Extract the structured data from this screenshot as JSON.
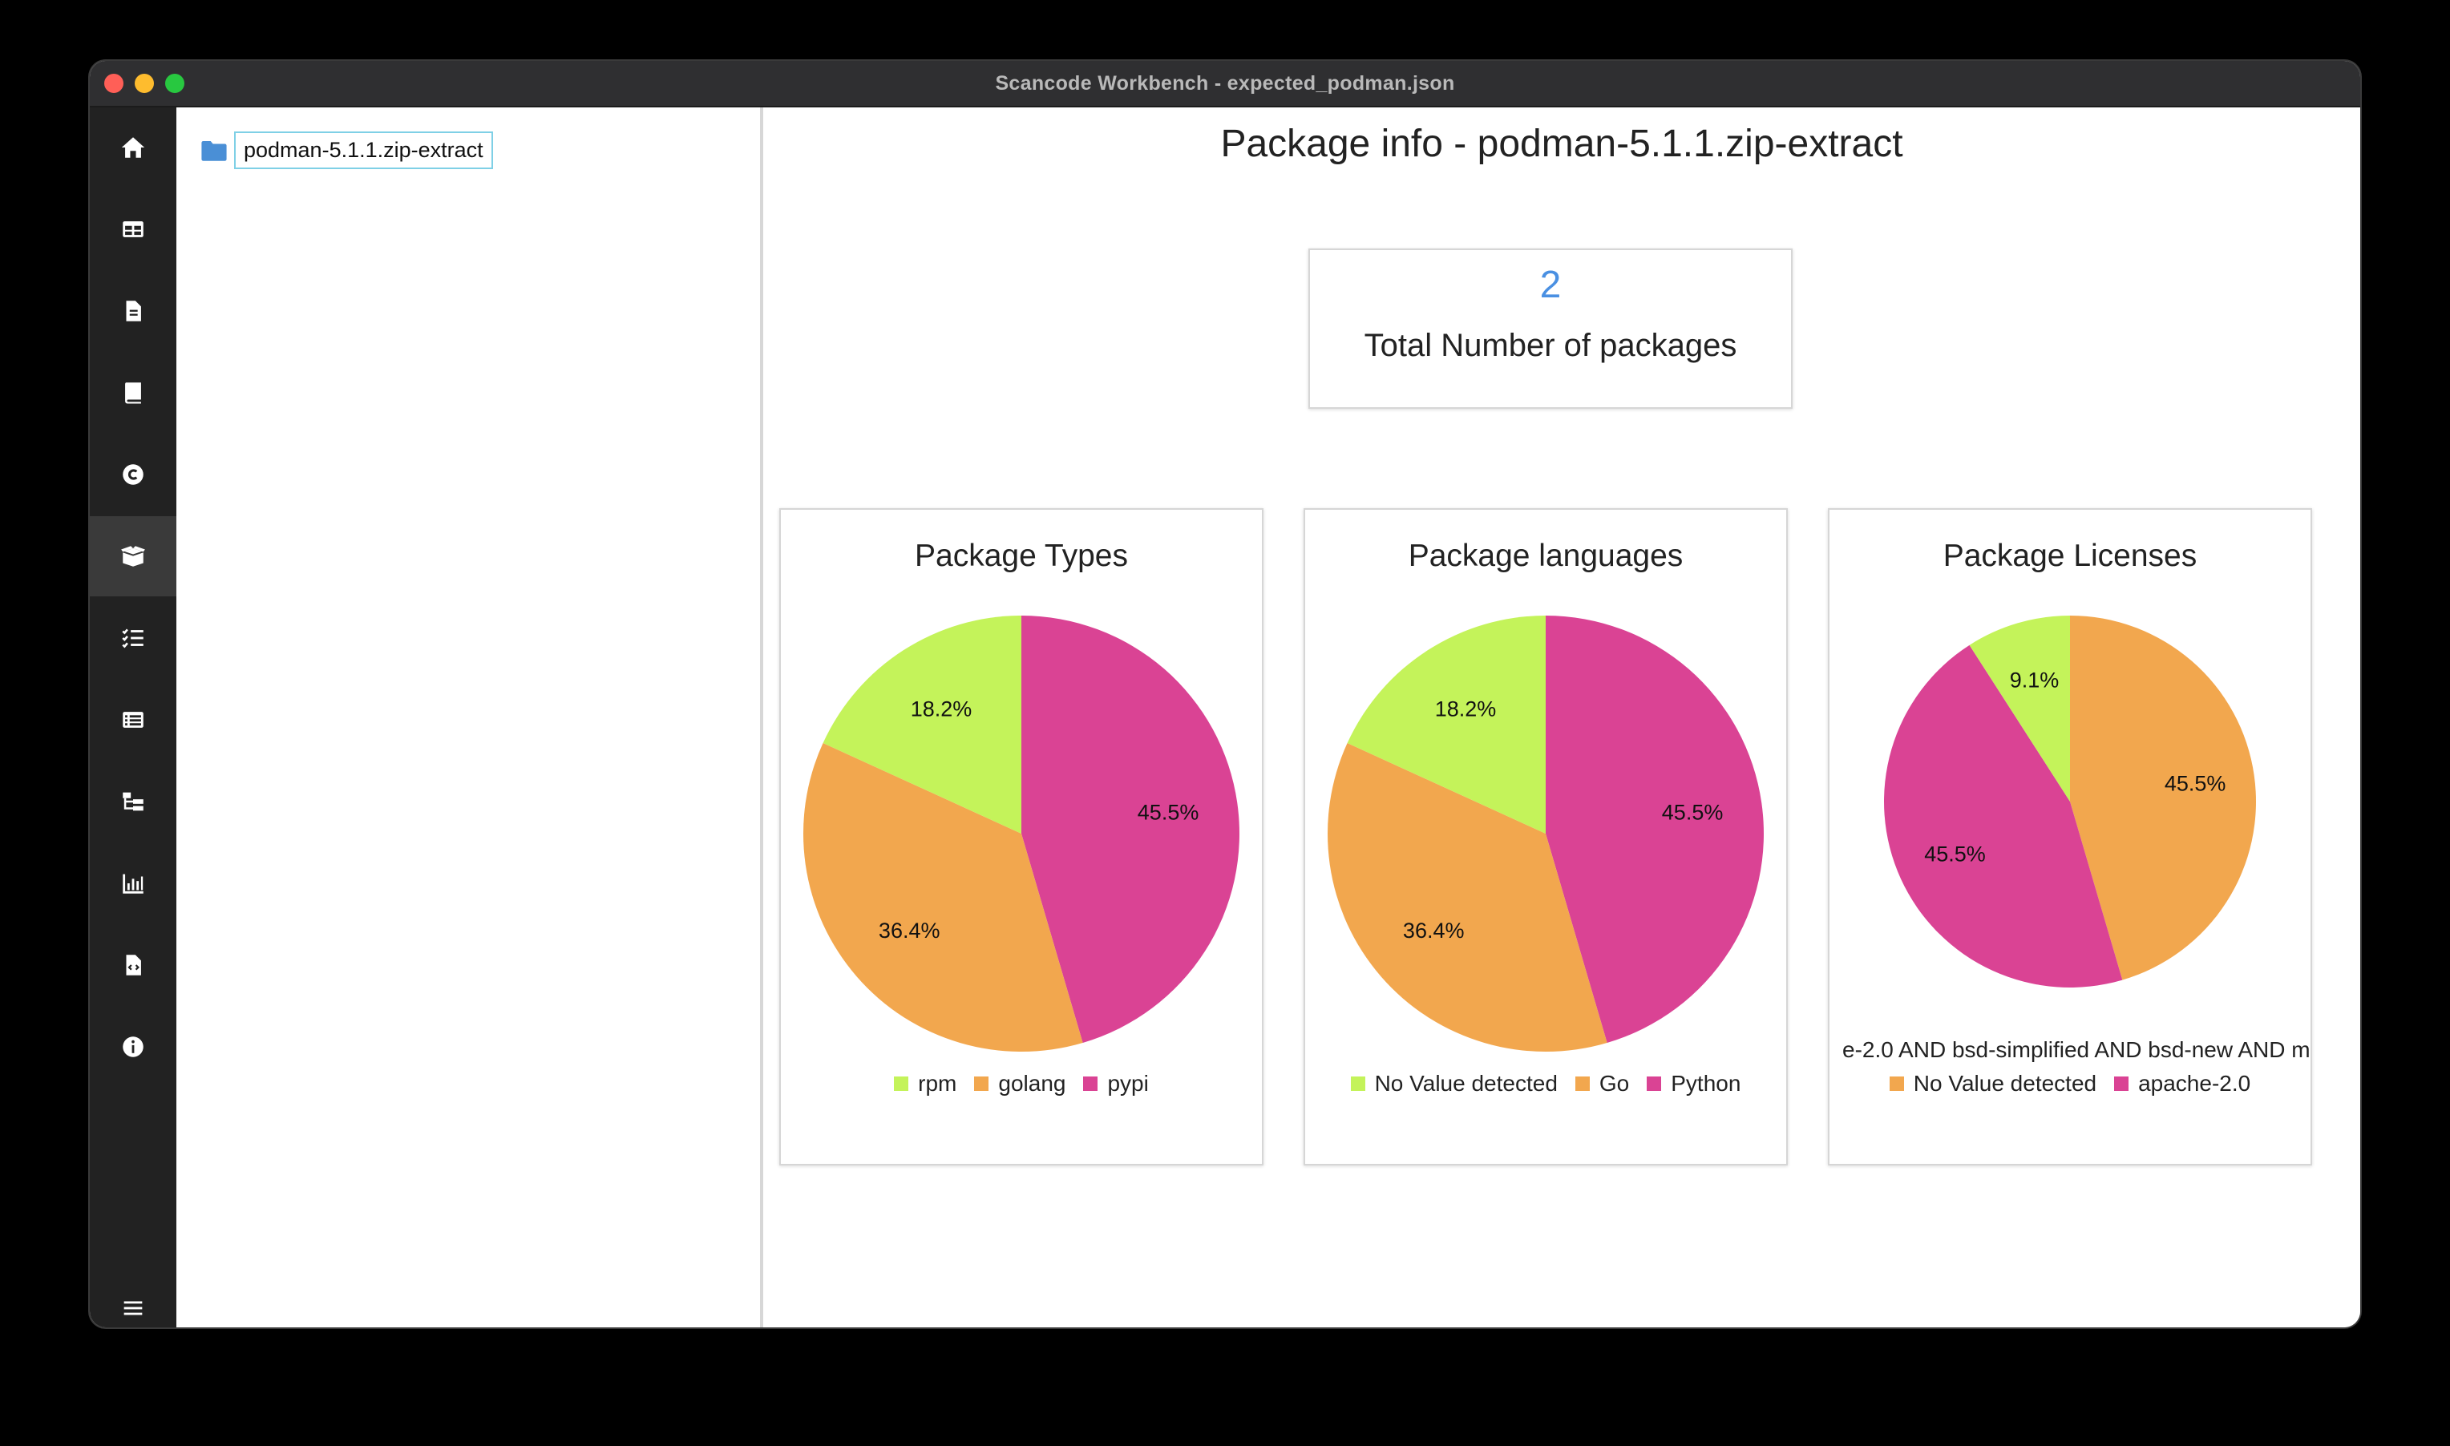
{
  "window": {
    "title": "Scancode Workbench - expected_podman.json"
  },
  "sidebar": {
    "items": [
      {
        "icon": "home-icon"
      },
      {
        "icon": "table-icon"
      },
      {
        "icon": "file-icon"
      },
      {
        "icon": "book-icon"
      },
      {
        "icon": "copyright-icon"
      },
      {
        "icon": "package-icon",
        "active": true
      },
      {
        "icon": "checklist-icon"
      },
      {
        "icon": "list-icon"
      },
      {
        "icon": "tree-icon"
      },
      {
        "icon": "bar-chart-icon"
      },
      {
        "icon": "file-code-icon"
      },
      {
        "icon": "info-icon"
      }
    ],
    "menu_icon": "menu-icon"
  },
  "file_tree": {
    "root_label": "podman-5.1.1.zip-extract",
    "icon": "folder-icon"
  },
  "main": {
    "title": "Package info - podman-5.1.1.zip-extract",
    "stat": {
      "value": "2",
      "label": "Total Number of packages"
    }
  },
  "colors": {
    "green": "#c4f35a",
    "orange": "#f2a74e",
    "pink": "#da4394",
    "accent": "#4a90e2"
  },
  "chart_data": [
    {
      "type": "pie",
      "title": "Package Types",
      "slices": [
        {
          "label": "rpm",
          "value": 18.2,
          "display": "18.2%",
          "color": "#c4f35a"
        },
        {
          "label": "golang",
          "value": 36.4,
          "display": "36.4%",
          "color": "#f2a74e"
        },
        {
          "label": "pypi",
          "value": 45.5,
          "display": "45.5%",
          "color": "#da4394"
        }
      ],
      "legend": [
        "rpm",
        "golang",
        "pypi"
      ]
    },
    {
      "type": "pie",
      "title": "Package languages",
      "slices": [
        {
          "label": "No Value detected",
          "value": 18.2,
          "display": "18.2%",
          "color": "#c4f35a"
        },
        {
          "label": "Go",
          "value": 36.4,
          "display": "36.4%",
          "color": "#f2a74e"
        },
        {
          "label": "Python",
          "value": 45.5,
          "display": "45.5%",
          "color": "#da4394"
        }
      ],
      "legend": [
        "No Value detected",
        "Go",
        "Python"
      ]
    },
    {
      "type": "pie",
      "title": "Package Licenses",
      "slices": [
        {
          "label": "e-2.0 AND bsd-simplified AND bsd-new AND m",
          "value": 9.1,
          "display": "9.1%",
          "color": "#c4f35a"
        },
        {
          "label": "No Value detected",
          "value": 45.5,
          "display": "45.5%",
          "color": "#f2a74e"
        },
        {
          "label": "apache-2.0",
          "value": 45.5,
          "display": "45.5%",
          "color": "#da4394"
        }
      ],
      "overflow_legend": "e-2.0 AND bsd-simplified AND bsd-new AND m",
      "legend": [
        "No Value detected",
        "apache-2.0"
      ]
    }
  ]
}
